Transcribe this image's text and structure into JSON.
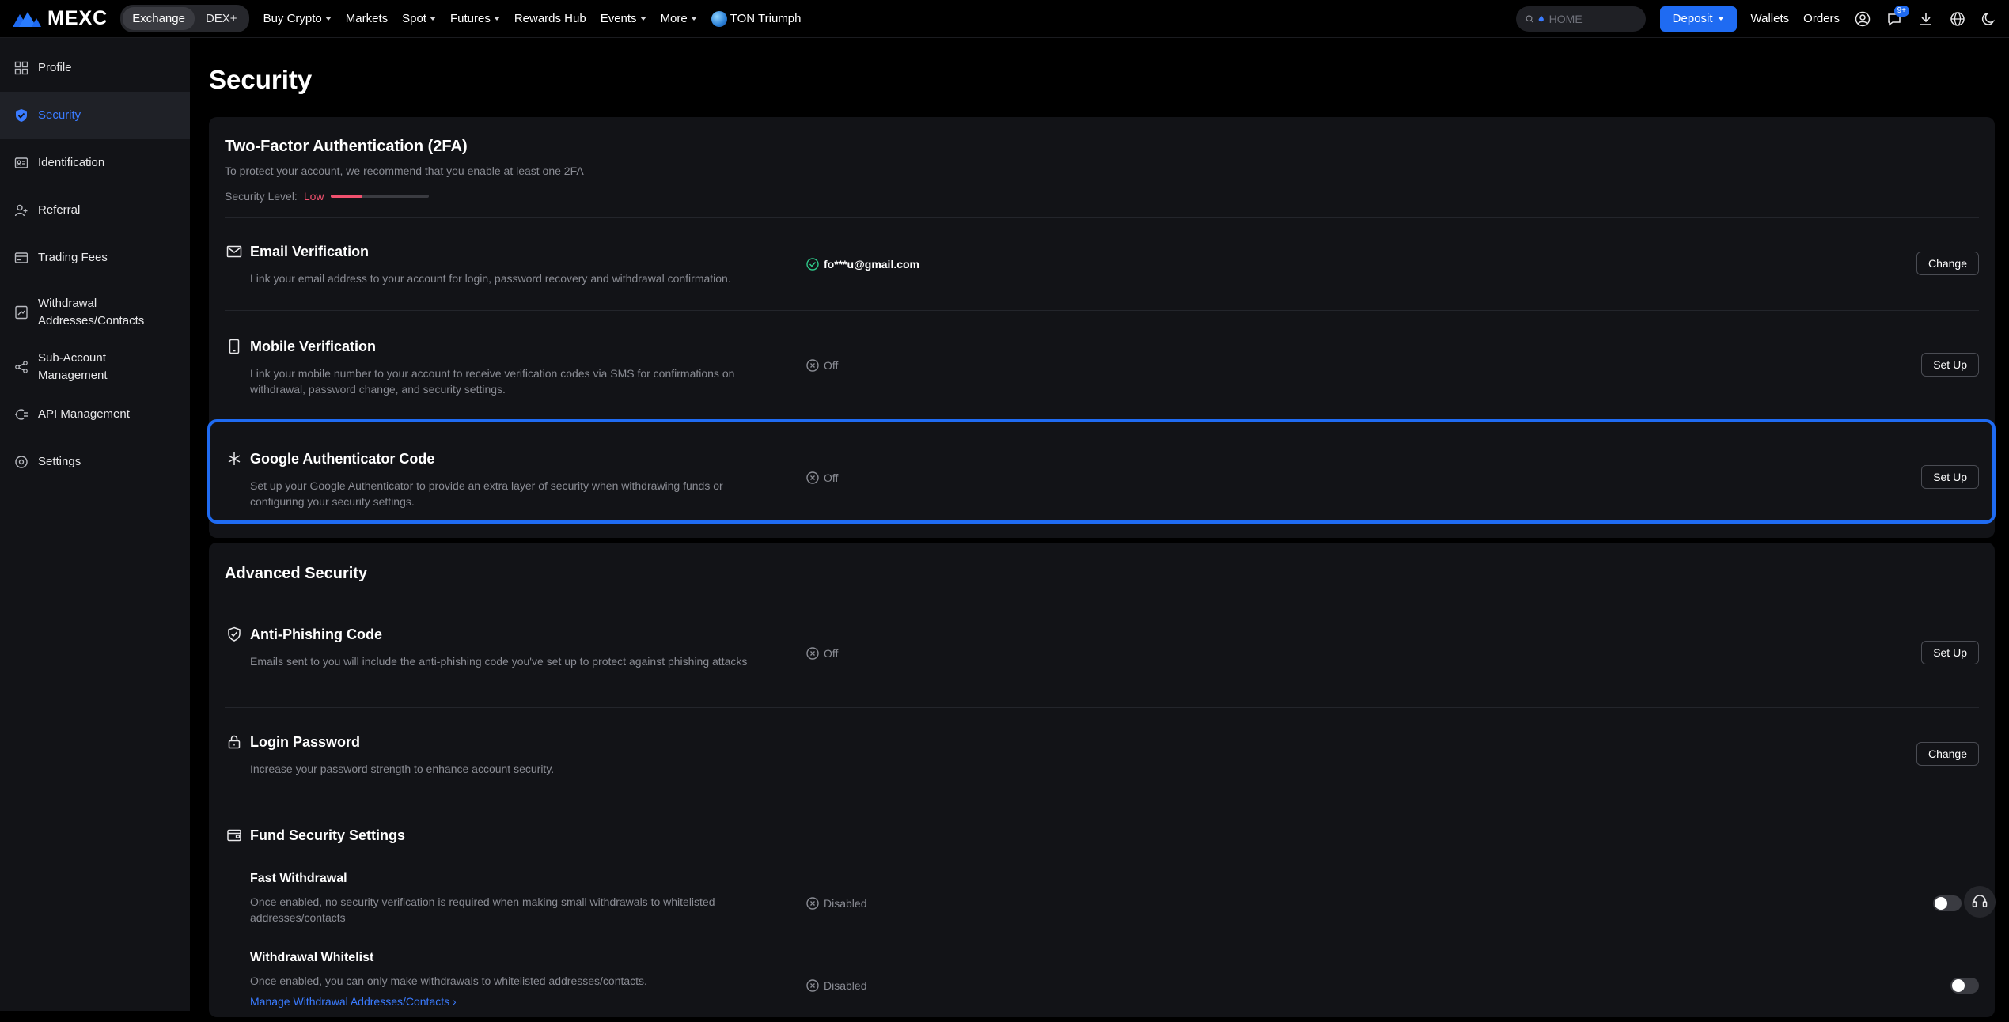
{
  "nav": {
    "logo": "MEXC",
    "segments": [
      "Exchange",
      "DEX+"
    ],
    "items": [
      {
        "label": "Buy Crypto",
        "dropdown": true
      },
      {
        "label": "Markets",
        "dropdown": false
      },
      {
        "label": "Spot",
        "dropdown": true
      },
      {
        "label": "Futures",
        "dropdown": true
      },
      {
        "label": "Rewards Hub",
        "dropdown": false
      },
      {
        "label": "Events",
        "dropdown": true
      },
      {
        "label": "More",
        "dropdown": true
      },
      {
        "label": "TON Triumph",
        "dropdown": false
      }
    ],
    "search_placeholder": "HOME",
    "deposit_label": "Deposit",
    "wallets_label": "Wallets",
    "orders_label": "Orders",
    "notification_badge": "9+"
  },
  "sidebar": {
    "items": [
      {
        "label": "Profile",
        "icon": "profile-icon"
      },
      {
        "label": "Security",
        "icon": "shield-icon",
        "active": true
      },
      {
        "label": "Identification",
        "icon": "id-card-icon"
      },
      {
        "label": "Referral",
        "icon": "referral-icon"
      },
      {
        "label": "Trading Fees",
        "icon": "fees-icon"
      },
      {
        "label": "Withdrawal Addresses/Contacts",
        "icon": "address-book-icon"
      },
      {
        "label": "Sub-Account Management",
        "icon": "sub-account-icon"
      },
      {
        "label": "API Management",
        "icon": "api-icon"
      },
      {
        "label": "Settings",
        "icon": "gear-icon"
      }
    ]
  },
  "page": {
    "title": "Security"
  },
  "twofa": {
    "title": "Two-Factor Authentication (2FA)",
    "subtitle": "To protect your account, we recommend that you enable at least one 2FA",
    "level_label": "Security Level:",
    "level_value": "Low",
    "level_fraction": 0.33,
    "rows": [
      {
        "title": "Email Verification",
        "desc": "Link your email address to your account for login, password recovery and withdrawal confirmation.",
        "status": "fo***u@gmail.com",
        "button": "Change"
      },
      {
        "title": "Mobile Verification",
        "desc": "Link your mobile number to your account to receive verification codes via SMS for confirmations on withdrawal, password change, and security settings.",
        "status": "Off",
        "button": "Set Up"
      },
      {
        "title": "Google Authenticator Code",
        "desc": "Set up your Google Authenticator to provide an extra layer of security when withdrawing funds or configuring your security settings.",
        "status": "Off",
        "button": "Set Up"
      }
    ]
  },
  "advanced": {
    "title": "Advanced Security",
    "anti_phishing": {
      "title": "Anti-Phishing Code",
      "desc": "Emails sent to you will include the anti-phishing code you've set up to protect against phishing attacks",
      "status": "Off",
      "button": "Set Up"
    },
    "login_password": {
      "title": "Login Password",
      "desc": "Increase your password strength to enhance account security.",
      "button": "Change"
    },
    "fund_security": {
      "title": "Fund Security Settings",
      "fast_withdrawal": {
        "title": "Fast Withdrawal",
        "desc": "Once enabled, no security verification is required when making small withdrawals to whitelisted addresses/contacts",
        "status": "Disabled"
      },
      "whitelist": {
        "title": "Withdrawal Whitelist",
        "desc": "Once enabled, you can only make withdrawals to whitelisted addresses/contacts.",
        "status": "Disabled",
        "link": "Manage Withdrawal Addresses/Contacts"
      }
    }
  }
}
